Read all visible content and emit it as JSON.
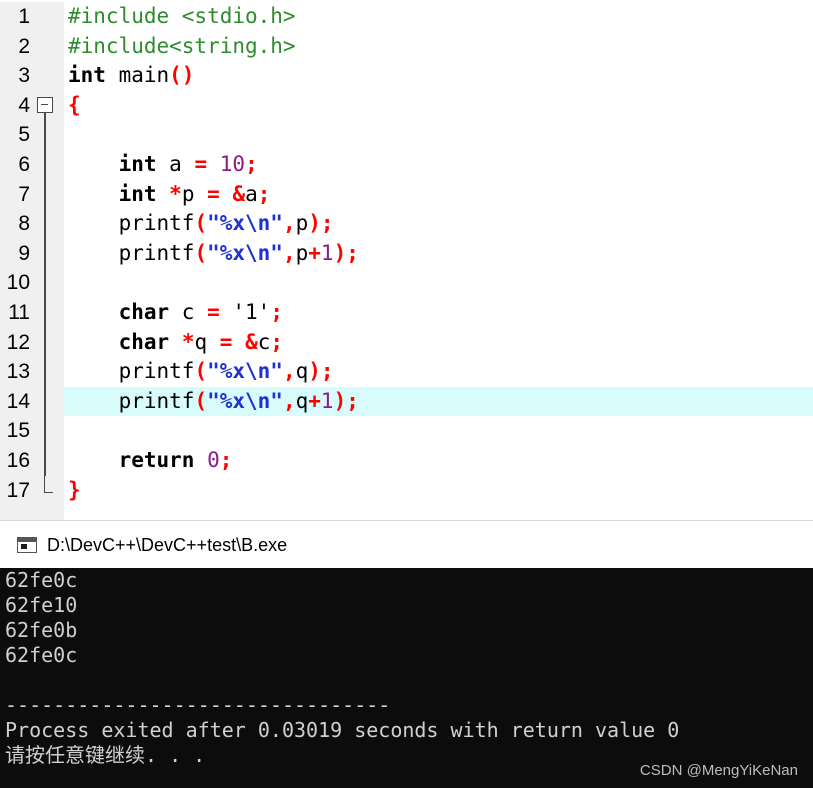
{
  "editor": {
    "lines": [
      {
        "num": "1",
        "tokens": [
          {
            "t": "#include <stdio.h>",
            "c": "pp"
          }
        ]
      },
      {
        "num": "2",
        "tokens": [
          {
            "t": "#include<string.h>",
            "c": "pp"
          }
        ]
      },
      {
        "num": "3",
        "tokens": [
          {
            "t": "int",
            "c": "kw"
          },
          {
            "t": " main",
            "c": "id"
          },
          {
            "t": "()",
            "c": "pun"
          }
        ]
      },
      {
        "num": "4",
        "tokens": [
          {
            "t": "{",
            "c": "pun"
          }
        ]
      },
      {
        "num": "5",
        "tokens": []
      },
      {
        "num": "6",
        "tokens": [
          {
            "t": "    ",
            "c": "id"
          },
          {
            "t": "int",
            "c": "kw"
          },
          {
            "t": " a ",
            "c": "id"
          },
          {
            "t": "=",
            "c": "pun"
          },
          {
            "t": " ",
            "c": "id"
          },
          {
            "t": "10",
            "c": "num"
          },
          {
            "t": ";",
            "c": "pun"
          }
        ]
      },
      {
        "num": "7",
        "tokens": [
          {
            "t": "    ",
            "c": "id"
          },
          {
            "t": "int",
            "c": "kw"
          },
          {
            "t": " ",
            "c": "id"
          },
          {
            "t": "*",
            "c": "pun"
          },
          {
            "t": "p ",
            "c": "id"
          },
          {
            "t": "=",
            "c": "pun"
          },
          {
            "t": " ",
            "c": "id"
          },
          {
            "t": "&",
            "c": "pun"
          },
          {
            "t": "a",
            "c": "id"
          },
          {
            "t": ";",
            "c": "pun"
          }
        ]
      },
      {
        "num": "8",
        "tokens": [
          {
            "t": "    printf",
            "c": "id"
          },
          {
            "t": "(",
            "c": "pun"
          },
          {
            "t": "\"%x\\n\"",
            "c": "str"
          },
          {
            "t": ",",
            "c": "pun"
          },
          {
            "t": "p",
            "c": "id"
          },
          {
            "t": ");",
            "c": "pun"
          }
        ]
      },
      {
        "num": "9",
        "tokens": [
          {
            "t": "    printf",
            "c": "id"
          },
          {
            "t": "(",
            "c": "pun"
          },
          {
            "t": "\"%x\\n\"",
            "c": "str"
          },
          {
            "t": ",",
            "c": "pun"
          },
          {
            "t": "p",
            "c": "id"
          },
          {
            "t": "+",
            "c": "pun"
          },
          {
            "t": "1",
            "c": "num"
          },
          {
            "t": ");",
            "c": "pun"
          }
        ]
      },
      {
        "num": "10",
        "tokens": []
      },
      {
        "num": "11",
        "tokens": [
          {
            "t": "    ",
            "c": "id"
          },
          {
            "t": "char",
            "c": "kw"
          },
          {
            "t": " c ",
            "c": "id"
          },
          {
            "t": "=",
            "c": "pun"
          },
          {
            "t": " '1'",
            "c": "id"
          },
          {
            "t": ";",
            "c": "pun"
          }
        ]
      },
      {
        "num": "12",
        "tokens": [
          {
            "t": "    ",
            "c": "id"
          },
          {
            "t": "char",
            "c": "kw"
          },
          {
            "t": " ",
            "c": "id"
          },
          {
            "t": "*",
            "c": "pun"
          },
          {
            "t": "q ",
            "c": "id"
          },
          {
            "t": "=",
            "c": "pun"
          },
          {
            "t": " ",
            "c": "id"
          },
          {
            "t": "&",
            "c": "pun"
          },
          {
            "t": "c",
            "c": "id"
          },
          {
            "t": ";",
            "c": "pun"
          }
        ]
      },
      {
        "num": "13",
        "tokens": [
          {
            "t": "    printf",
            "c": "id"
          },
          {
            "t": "(",
            "c": "pun"
          },
          {
            "t": "\"%x\\n\"",
            "c": "str"
          },
          {
            "t": ",",
            "c": "pun"
          },
          {
            "t": "q",
            "c": "id"
          },
          {
            "t": ");",
            "c": "pun"
          }
        ]
      },
      {
        "num": "14",
        "tokens": [
          {
            "t": "    printf",
            "c": "id"
          },
          {
            "t": "(",
            "c": "pun"
          },
          {
            "t": "\"%x\\n\"",
            "c": "str"
          },
          {
            "t": ",",
            "c": "pun"
          },
          {
            "t": "q",
            "c": "id"
          },
          {
            "t": "+",
            "c": "pun"
          },
          {
            "t": "1",
            "c": "num"
          },
          {
            "t": ");",
            "c": "pun"
          }
        ],
        "highlighted": true
      },
      {
        "num": "15",
        "tokens": []
      },
      {
        "num": "16",
        "tokens": [
          {
            "t": "    ",
            "c": "id"
          },
          {
            "t": "return",
            "c": "kw"
          },
          {
            "t": " ",
            "c": "id"
          },
          {
            "t": "0",
            "c": "num"
          },
          {
            "t": ";",
            "c": "pun"
          }
        ]
      },
      {
        "num": "17",
        "tokens": [
          {
            "t": "}",
            "c": "pun"
          }
        ]
      }
    ],
    "colors": {
      "preprocessor": "#2e8b2e",
      "punctuation": "#ff0000",
      "number": "#8b1a8b",
      "string": "#1e32d2",
      "current_line": "#d8fcfc",
      "gutter": "#f0f0f0"
    }
  },
  "console": {
    "title": "D:\\DevC++\\DevC++test\\B.exe",
    "icon": "console-window-icon",
    "output": [
      "62fe0c",
      "62fe10",
      "62fe0b",
      "62fe0c",
      "",
      "--------------------------------",
      "Process exited after 0.03019 seconds with return value 0",
      "请按任意键继续. . ."
    ]
  },
  "watermark": "CSDN @MengYiKeNan"
}
